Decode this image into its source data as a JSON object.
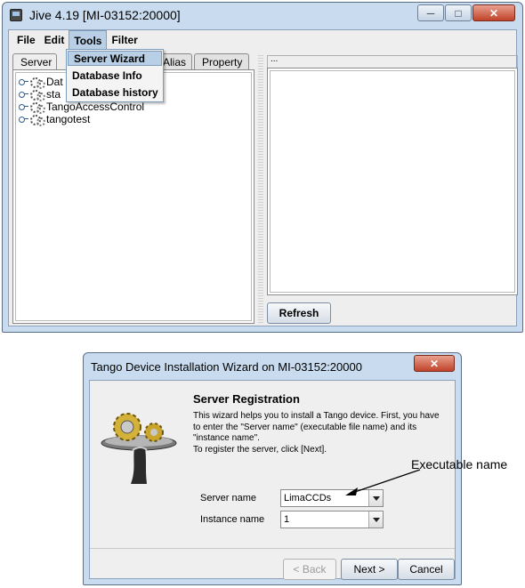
{
  "jive_window": {
    "title": "Jive 4.19  [MI-03152:20000]",
    "controls": {
      "minimize": "─",
      "maximize": "□",
      "close": "✕"
    },
    "menu": [
      "File",
      "Edit",
      "Tools",
      "Filter"
    ],
    "tools_menu": {
      "items": [
        "Server Wizard",
        "Database Info",
        "Database history"
      ]
    },
    "tabs": [
      "Server",
      "Alias",
      "Property"
    ],
    "tree_items": [
      "Dat",
      "sta",
      "TangoAccessControl",
      "tangotest"
    ],
    "right_panel_header": "...",
    "refresh_button": "Refresh"
  },
  "wizard_window": {
    "title": "Tango Device Installation Wizard on MI-03152:20000",
    "close": "✕",
    "heading": "Server Registration",
    "description": [
      "This wizard helps you to install a Tango device. First, you have",
      "to enter the \"Server name\" (executable file name) and its",
      "\"instance name\".",
      "To register the server, click [Next]."
    ],
    "server_name_label": "Server name",
    "server_name_value": "LimaCCDs",
    "instance_name_label": "Instance name",
    "instance_name_value": "1",
    "buttons": {
      "back": "< Back",
      "next": "Next >",
      "cancel": "Cancel"
    }
  },
  "annotation": {
    "text": "Executable name"
  },
  "colors": {
    "window_frame": "#c9dcef",
    "close_button": "#c0432a",
    "menu_highlight": "#b8cfe5"
  }
}
